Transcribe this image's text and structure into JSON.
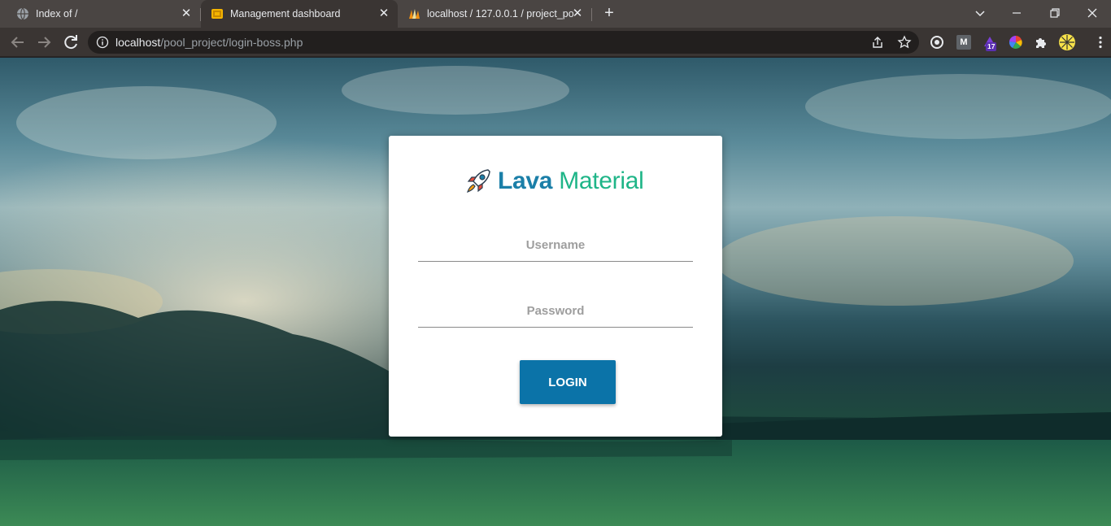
{
  "browser": {
    "tabs": [
      {
        "title": "Index of /",
        "icon": "globe-icon"
      },
      {
        "title": "Management dashboard",
        "icon": "dashboard-favicon"
      },
      {
        "title": "localhost / 127.0.0.1 / project_po",
        "icon": "phpmyadmin-favicon"
      }
    ],
    "new_tab_label": "+",
    "url": {
      "host": "localhost",
      "path": "/pool_project/login-boss.php"
    },
    "extensions": [
      {
        "name": "extension-a-icon"
      },
      {
        "name": "extension-m-icon",
        "label": "M"
      },
      {
        "name": "extension-badge-icon",
        "badge": "17"
      },
      {
        "name": "color-wheel-icon"
      },
      {
        "name": "puzzle-icon"
      },
      {
        "name": "profile-avatar-icon"
      }
    ]
  },
  "login": {
    "brand_bold": "Lava",
    "brand_light": "Material",
    "username_placeholder": "Username",
    "password_placeholder": "Password",
    "login_label": "LOGIN"
  },
  "colors": {
    "primary": "#0b73a8",
    "brand_blue": "#1b7fa8",
    "brand_green": "#1fb588"
  }
}
